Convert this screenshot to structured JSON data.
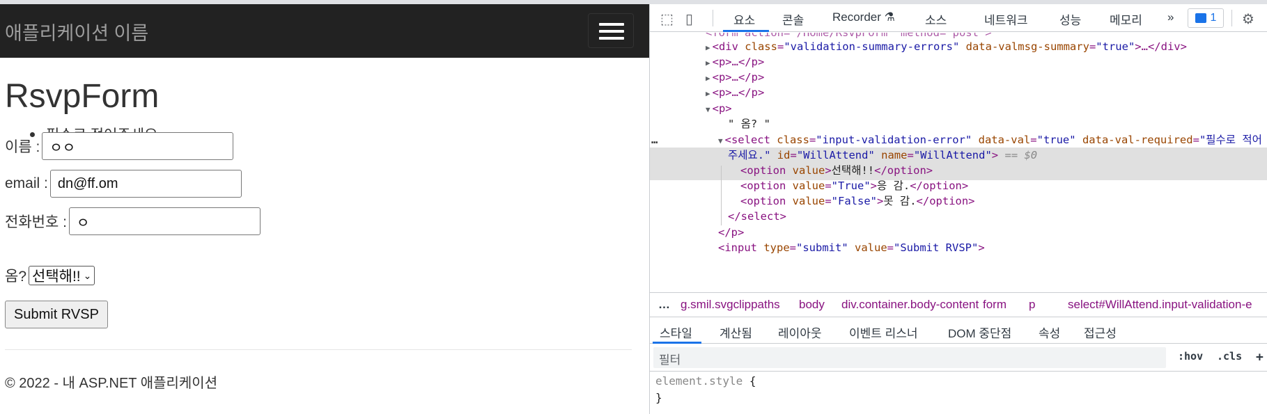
{
  "app": {
    "brand": "애플리케이션 이름",
    "page_heading": "RsvpForm",
    "validation_errors": [
      "필수로 적어주세요."
    ],
    "fields": {
      "name": {
        "label": "이름 :",
        "value": "ㅇㅇ"
      },
      "email": {
        "label": "email :",
        "value": "dn@ff.om"
      },
      "phone": {
        "label": "전화번호 :",
        "value": "ㅇ"
      },
      "attend": {
        "label": "옴?",
        "selected": "선택해!!"
      }
    },
    "submit_label": "Submit RVSP",
    "footer": "© 2022 - 내 ASP.NET 애플리케이션"
  },
  "devtools": {
    "tabs": [
      "요소",
      "콘솔",
      "Recorder ⚗",
      "소스",
      "네트워크",
      "성능",
      "메모리",
      "»"
    ],
    "active_tab": "요소",
    "issues_count": "1",
    "dom_lines": {
      "l0": "<form action=\"/Home/RsvpForm\" method=\"post\">",
      "l1_tag_open": "<div ",
      "l1_attr1": "class",
      "l1_val1": "\"validation-summary-errors\"",
      "l1_attr2": "data-valmsg-summary",
      "l1_val2": "\"true\"",
      "l1_tail": ">…</div>",
      "p_collapsed": "<p>…</p>",
      "p_open": "<p>",
      "text_node": "\" 옴? \"",
      "select_tag": "<select ",
      "select_attr1": "class",
      "select_val1": "\"input-validation-error\"",
      "select_attr2": "data-val",
      "select_val2": "\"true\"",
      "select_attr3": "data-val-required",
      "select_val3_part1": "\"필수로 적어",
      "select_val3_part2": "주세요.\"",
      "select_attr4": "id",
      "select_val4": "\"WillAttend\"",
      "select_attr5": "name",
      "select_val5": "\"WillAttend\"",
      "select_close": ">",
      "dollar0": "== $0",
      "opt1_open": "<option ",
      "opt1_attr": "value",
      "opt1_text": "선택해!!",
      "opt2_attr": "value",
      "opt2_val": "\"True\"",
      "opt2_text": "응 감.",
      "opt3_attr": "value",
      "opt3_val": "\"False\"",
      "opt3_text": "못 감.",
      "option_close": "</option>",
      "select_end": "</select>",
      "p_end": "</p>",
      "input_tag": "<input ",
      "input_attr1": "type",
      "input_val1": "\"submit\"",
      "input_attr2": "value",
      "input_val2": "\"Submit RVSP\"",
      "input_close": ">",
      "ellipsis": "…"
    },
    "breadcrumbs": [
      "…",
      "g.smil.svgclippaths",
      "body",
      "div.container.body-content",
      "form",
      "p",
      "select#WillAttend.input-validation-e"
    ],
    "subtabs": [
      "스타일",
      "계산됨",
      "레이아웃",
      "이벤트 리스너",
      "DOM 중단점",
      "속성",
      "접근성"
    ],
    "active_subtab": "스타일",
    "filter_placeholder": "필터",
    "filter_tools": [
      ":hov",
      ".cls",
      "+"
    ],
    "style_rule": {
      "selector": "element.style",
      "open": "{",
      "close": "}"
    }
  },
  "colors": {
    "navbar": "#222222",
    "accent": "#1a73e8",
    "tag": "#881280",
    "attr": "#994500",
    "attr_value": "#1a1aa6"
  }
}
